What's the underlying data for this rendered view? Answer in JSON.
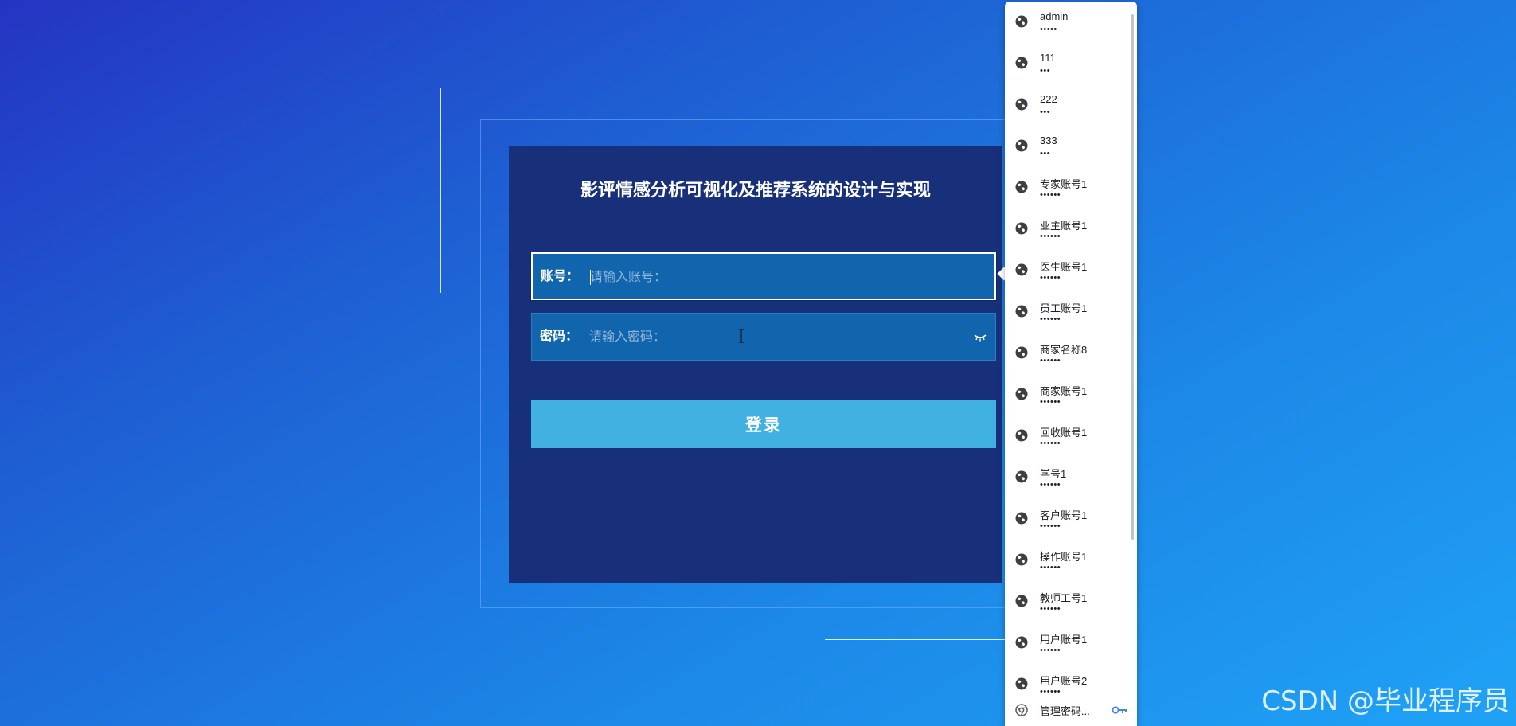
{
  "page": {
    "title": "影评情感分析可视化及推荐系统的设计与实现"
  },
  "form": {
    "account_label": "账号：",
    "account_placeholder": "请输入账号：",
    "password_label": "密码：",
    "password_placeholder": "请输入密码：",
    "login_label": "登录"
  },
  "password_popup": {
    "items": [
      {
        "username": "admin",
        "mask": "•••••"
      },
      {
        "username": "111",
        "mask": "•••"
      },
      {
        "username": "222",
        "mask": "•••"
      },
      {
        "username": "333",
        "mask": "•••"
      },
      {
        "username": "专家账号1",
        "mask": "••••••"
      },
      {
        "username": "业主账号1",
        "mask": "••••••"
      },
      {
        "username": "医生账号1",
        "mask": "••••••"
      },
      {
        "username": "员工账号1",
        "mask": "••••••"
      },
      {
        "username": "商家名称8",
        "mask": "••••••"
      },
      {
        "username": "商家账号1",
        "mask": "••••••"
      },
      {
        "username": "回收账号1",
        "mask": "••••••"
      },
      {
        "username": "学号1",
        "mask": "••••••"
      },
      {
        "username": "客户账号1",
        "mask": "••••••"
      },
      {
        "username": "操作账号1",
        "mask": "••••••"
      },
      {
        "username": "教师工号1",
        "mask": "••••••"
      },
      {
        "username": "用户账号1",
        "mask": "••••••"
      },
      {
        "username": "用户账号2",
        "mask": "••••••"
      }
    ],
    "item_icon": "globe-icon",
    "manage_label": "管理密码...",
    "manage_icon": "chrome-icon",
    "key_icon": "key-icon"
  },
  "watermark": "CSDN @毕业程序员",
  "colors": {
    "panel": "#18307a",
    "field": "#1065ad",
    "login_button": "#41b1e1"
  }
}
